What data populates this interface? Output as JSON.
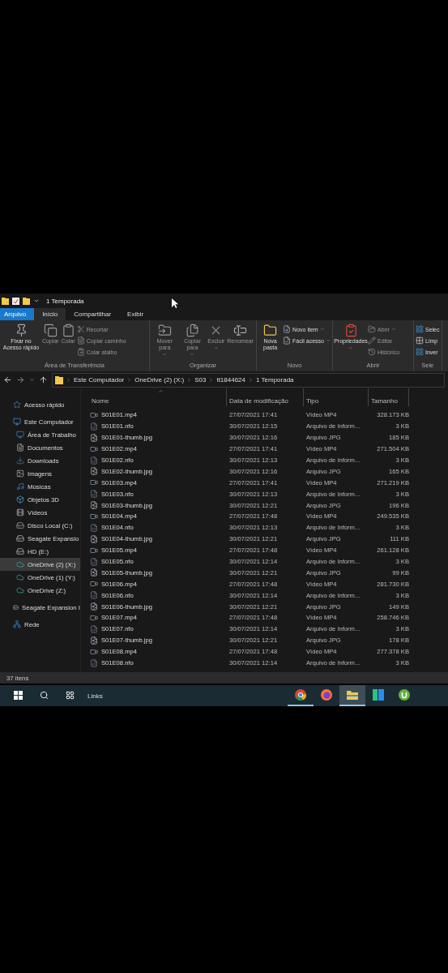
{
  "title_bar": {
    "title": "1 Temporada"
  },
  "ribbon_tabs": [
    {
      "label": "Arquivo",
      "kind": "file",
      "selected": false
    },
    {
      "label": "Início",
      "kind": "tab",
      "selected": true
    },
    {
      "label": "Compartilhar",
      "kind": "tab",
      "selected": false
    },
    {
      "label": "Exibir",
      "kind": "tab",
      "selected": false
    }
  ],
  "ribbon_groups": [
    {
      "label": "Área de Transferência",
      "items": [
        {
          "label": "Fixar no Acesso rápido",
          "kind": "large",
          "disabled": false,
          "dropdown": false
        },
        {
          "label": "Copiar",
          "kind": "large",
          "disabled": true,
          "dropdown": false
        },
        {
          "label": "Colar",
          "kind": "large",
          "disabled": true,
          "dropdown": false
        },
        {
          "label": "Recortar",
          "kind": "small",
          "disabled": true,
          "dropdown": false
        },
        {
          "label": "Copiar caminho",
          "kind": "small",
          "disabled": true,
          "dropdown": false
        },
        {
          "label": "Colar atalho",
          "kind": "small",
          "disabled": true,
          "dropdown": false
        }
      ]
    },
    {
      "label": "Organizar",
      "items": [
        {
          "label": "Mover para",
          "kind": "large",
          "disabled": true,
          "dropdown": true
        },
        {
          "label": "Copiar para",
          "kind": "large",
          "disabled": true,
          "dropdown": true
        },
        {
          "label": "Excluir",
          "kind": "large",
          "disabled": true,
          "dropdown": true
        },
        {
          "label": "Renomear",
          "kind": "large",
          "disabled": true,
          "dropdown": false
        }
      ]
    },
    {
      "label": "Novo",
      "items": [
        {
          "label": "Nova pasta",
          "kind": "large",
          "disabled": false,
          "dropdown": false
        },
        {
          "label": "Novo item",
          "kind": "small",
          "disabled": false,
          "dropdown": true
        },
        {
          "label": "Fácil acesso",
          "kind": "small",
          "disabled": false,
          "dropdown": true
        }
      ]
    },
    {
      "label": "Abrir",
      "items": [
        {
          "label": "Propriedades",
          "kind": "large",
          "disabled": false,
          "dropdown": true
        },
        {
          "label": "Abrir",
          "kind": "small",
          "disabled": true,
          "dropdown": true
        },
        {
          "label": "Editar",
          "kind": "small",
          "disabled": true,
          "dropdown": false
        },
        {
          "label": "Histórico",
          "kind": "small",
          "disabled": true,
          "dropdown": false
        }
      ]
    },
    {
      "label": "Sele",
      "items": [
        {
          "label": "Selec",
          "kind": "small",
          "disabled": false,
          "dropdown": false
        },
        {
          "label": "Limp",
          "kind": "small",
          "disabled": false,
          "dropdown": false
        },
        {
          "label": "Inver",
          "kind": "small",
          "disabled": false,
          "dropdown": false
        }
      ]
    }
  ],
  "breadcrumb": [
    "Este Computador",
    "OneDrive (2) (X:)",
    "S03",
    "tt1844624",
    "1 Temporada"
  ],
  "sidebar": [
    {
      "label": "Acesso rápido",
      "kind": "quick",
      "selected": false
    },
    {
      "label": "Este Computador",
      "kind": "computer",
      "selected": false,
      "children": [
        {
          "label": "Área de Trabalho",
          "kind": "desktop",
          "selected": false
        },
        {
          "label": "Documentos",
          "kind": "documents",
          "selected": false
        },
        {
          "label": "Downloads",
          "kind": "downloads",
          "selected": false
        },
        {
          "label": "Imagens",
          "kind": "pictures",
          "selected": false
        },
        {
          "label": "Músicas",
          "kind": "music",
          "selected": false
        },
        {
          "label": "Objetos 3D",
          "kind": "objects",
          "selected": false
        },
        {
          "label": "Vídeos",
          "kind": "videos",
          "selected": false
        },
        {
          "label": "Disco Local (C:)",
          "kind": "disk",
          "selected": false
        },
        {
          "label": "Seagate Expansio",
          "kind": "drive",
          "selected": false
        },
        {
          "label": "HD  (E:)",
          "kind": "drive",
          "selected": false
        },
        {
          "label": "OneDrive (2) (X:)",
          "kind": "cloud",
          "selected": true
        },
        {
          "label": "OneDrive (1) (Y:)",
          "kind": "cloud",
          "selected": false
        },
        {
          "label": "OneDrive (Z:)",
          "kind": "cloud",
          "selected": false
        }
      ]
    },
    {
      "label": "Seagate Expansion I",
      "kind": "drive",
      "selected": false
    },
    {
      "label": "Rede",
      "kind": "network",
      "selected": false
    }
  ],
  "table": {
    "columns": [
      {
        "label": "Nome",
        "sorted": true
      },
      {
        "label": "Data de modificação",
        "sorted": false
      },
      {
        "label": "Tipo",
        "sorted": false
      },
      {
        "label": "Tamanho",
        "sorted": false
      }
    ],
    "rows": [
      {
        "kind": "video",
        "name": "S01E01.mp4",
        "date": "27/07/2021 17:41",
        "type": "Vídeo MP4",
        "size": "328.173 KB"
      },
      {
        "kind": "nfo",
        "name": "S01E01.nfo",
        "date": "30/07/2021 12:15",
        "type": "Arquivo de Inform...",
        "size": "3 KB"
      },
      {
        "kind": "image",
        "name": "S01E01-thumb.jpg",
        "date": "30/07/2021 12:16",
        "type": "Arquivo JPG",
        "size": "185 KB"
      },
      {
        "kind": "video",
        "name": "S01E02.mp4",
        "date": "27/07/2021 17:41",
        "type": "Vídeo MP4",
        "size": "271.504 KB"
      },
      {
        "kind": "nfo",
        "name": "S01E02.nfo",
        "date": "30/07/2021 12:13",
        "type": "Arquivo de Inform...",
        "size": "3 KB"
      },
      {
        "kind": "image",
        "name": "S01E02-thumb.jpg",
        "date": "30/07/2021 12:16",
        "type": "Arquivo JPG",
        "size": "165 KB"
      },
      {
        "kind": "video",
        "name": "S01E03.mp4",
        "date": "27/07/2021 17:41",
        "type": "Vídeo MP4",
        "size": "271.219 KB"
      },
      {
        "kind": "nfo",
        "name": "S01E03.nfo",
        "date": "30/07/2021 12:13",
        "type": "Arquivo de Inform...",
        "size": "3 KB"
      },
      {
        "kind": "image",
        "name": "S01E03-thumb.jpg",
        "date": "30/07/2021 12:21",
        "type": "Arquivo JPG",
        "size": "196 KB"
      },
      {
        "kind": "video",
        "name": "S01E04.mp4",
        "date": "27/07/2021 17:48",
        "type": "Vídeo MP4",
        "size": "249.535 KB"
      },
      {
        "kind": "nfo",
        "name": "S01E04.nfo",
        "date": "30/07/2021 12:13",
        "type": "Arquivo de Inform...",
        "size": "3 KB"
      },
      {
        "kind": "image",
        "name": "S01E04-thumb.jpg",
        "date": "30/07/2021 12:21",
        "type": "Arquivo JPG",
        "size": "111 KB"
      },
      {
        "kind": "video",
        "name": "S01E05.mp4",
        "date": "27/07/2021 17:48",
        "type": "Vídeo MP4",
        "size": "261.128 KB"
      },
      {
        "kind": "nfo",
        "name": "S01E05.nfo",
        "date": "30/07/2021 12:14",
        "type": "Arquivo de Inform...",
        "size": "3 KB"
      },
      {
        "kind": "image",
        "name": "S01E05-thumb.jpg",
        "date": "30/07/2021 12:21",
        "type": "Arquivo JPG",
        "size": "99 KB"
      },
      {
        "kind": "video",
        "name": "S01E06.mp4",
        "date": "27/07/2021 17:48",
        "type": "Vídeo MP4",
        "size": "281.730 KB"
      },
      {
        "kind": "nfo",
        "name": "S01E06.nfo",
        "date": "30/07/2021 12:14",
        "type": "Arquivo de Inform...",
        "size": "3 KB"
      },
      {
        "kind": "image",
        "name": "S01E06-thumb.jpg",
        "date": "30/07/2021 12:21",
        "type": "Arquivo JPG",
        "size": "149 KB"
      },
      {
        "kind": "video",
        "name": "S01E07.mp4",
        "date": "27/07/2021 17:48",
        "type": "Vídeo MP4",
        "size": "258.746 KB"
      },
      {
        "kind": "nfo",
        "name": "S01E07.nfo",
        "date": "30/07/2021 12:14",
        "type": "Arquivo de Inform...",
        "size": "3 KB"
      },
      {
        "kind": "image",
        "name": "S01E07-thumb.jpg",
        "date": "30/07/2021 12:21",
        "type": "Arquivo JPG",
        "size": "178 KB"
      },
      {
        "kind": "video",
        "name": "S01E08.mp4",
        "date": "27/07/2021 17:48",
        "type": "Vídeo MP4",
        "size": "277.378 KB"
      },
      {
        "kind": "nfo",
        "name": "S01E08.nfo",
        "date": "30/07/2021 12:14",
        "type": "Arquivo de Inform...",
        "size": "3 KB"
      }
    ]
  },
  "status_bar": {
    "count": "37 itens"
  },
  "taskbar": {
    "toolbar_label": "Links",
    "apps": [
      {
        "kind": "chrome",
        "running": true,
        "selected": false
      },
      {
        "kind": "firefox",
        "running": false,
        "selected": false
      },
      {
        "kind": "explorer",
        "running": true,
        "selected": true
      },
      {
        "kind": "tiles",
        "running": false,
        "selected": false
      },
      {
        "kind": "torrent",
        "running": false,
        "selected": false
      }
    ]
  }
}
